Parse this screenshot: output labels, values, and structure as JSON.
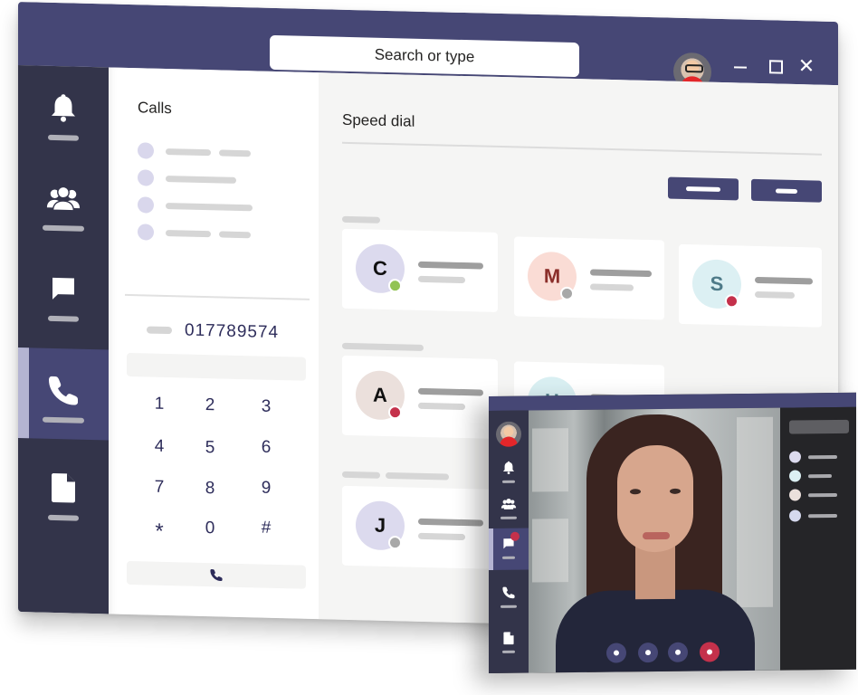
{
  "titlebar": {
    "search_placeholder": "Search or type",
    "user_avatar": "user-profile-photo",
    "window_controls": {
      "minimize": "minimize-icon",
      "maximize": "maximize-icon",
      "close": "✕"
    }
  },
  "sidebar": {
    "items": [
      {
        "id": "activity",
        "icon": "bell-icon",
        "active": false
      },
      {
        "id": "teams",
        "icon": "people-icon",
        "active": false
      },
      {
        "id": "chat",
        "icon": "chat-icon",
        "active": false
      },
      {
        "id": "calls",
        "icon": "phone-icon",
        "active": true
      },
      {
        "id": "files",
        "icon": "file-icon",
        "active": false
      }
    ]
  },
  "calls": {
    "title": "Calls",
    "recent_count": 4,
    "dialed_number": "017789574",
    "keypad": [
      "1",
      "2",
      "3",
      "4",
      "5",
      "6",
      "7",
      "8",
      "9",
      "*",
      "0",
      "#"
    ],
    "call_button_icon": "phone-icon"
  },
  "speed_dial": {
    "title": "Speed dial",
    "contacts": [
      {
        "initial": "C",
        "avatar_color": "#dcdaee",
        "text_color": "#111111",
        "presence": "available",
        "presence_color": "#92c353"
      },
      {
        "initial": "M",
        "avatar_color": "#fadcd5",
        "text_color": "#8b2e2a",
        "presence": "offline",
        "presence_color": "#a8a8a8"
      },
      {
        "initial": "S",
        "avatar_color": "#dcf0f3",
        "text_color": "#4e7a88",
        "presence": "busy",
        "presence_color": "#c4314b"
      },
      {
        "initial": "A",
        "avatar_color": "#ebe0dc",
        "text_color": "#111111",
        "presence": "busy",
        "presence_color": "#c4314b"
      },
      {
        "initial": "H",
        "avatar_color": "#d9eff2",
        "text_color": "#4e7a88",
        "presence": "",
        "presence_color": ""
      },
      {
        "initial": "J",
        "avatar_color": "#dcdaee",
        "text_color": "#111111",
        "presence": "offline",
        "presence_color": "#a8a8a8"
      }
    ]
  },
  "video_call": {
    "sidebar_items": [
      "bell-icon",
      "people-icon",
      "chat-icon",
      "phone-icon",
      "file-icon"
    ],
    "active_item": "chat",
    "chat_badge": true,
    "controls": [
      "video-toggle",
      "mic-toggle",
      "share",
      "hang-up"
    ],
    "roster_colors": [
      "#dcdaee",
      "#dcf0f3",
      "#ebe0dc",
      "#d5d9ee"
    ]
  },
  "colors": {
    "brand": "#464775",
    "rail": "#33344a",
    "accent_light": "#b4b4d2",
    "busy": "#c4314b",
    "available": "#92c353"
  }
}
